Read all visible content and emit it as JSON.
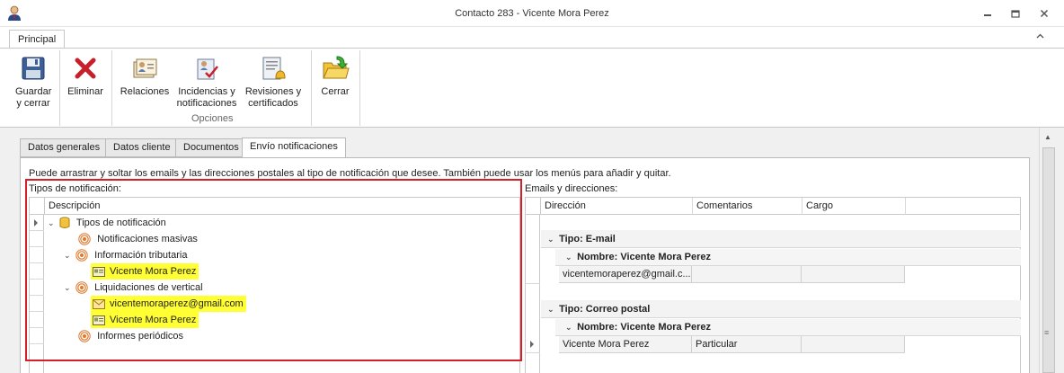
{
  "window": {
    "title": "Contacto 283 - Vicente Mora Perez",
    "minimize_icon": "minimize-icon",
    "restore_icon": "restore-icon",
    "close_icon": "close-icon"
  },
  "ribbon": {
    "tab": "Principal",
    "buttons": {
      "save": "Guardar y cerrar",
      "delete": "Eliminar",
      "relations": "Relaciones",
      "incidents": "Incidencias y notificaciones",
      "revisions": "Revisiones y certificados",
      "close": "Cerrar"
    },
    "group_label": "Opciones"
  },
  "tabs": [
    "Datos generales",
    "Datos cliente",
    "Documentos",
    "Envío notificaciones"
  ],
  "active_tab": "Envío notificaciones",
  "instructions": "Puede arrastrar y soltar los emails y las direcciones postales al tipo de notificación que desee. También puede usar los menús para añadir y quitar.",
  "left": {
    "label": "Tipos de notificación:",
    "column": "Descripción",
    "tree": {
      "root": "Tipos de notificación",
      "n1": "Notificaciones masivas",
      "n2": "Información tributaria",
      "n2_child": "Vicente Mora Perez",
      "n3": "Liquidaciones de vertical",
      "n3_email": "vicentemoraperez@gmail.com",
      "n3_child": "Vicente Mora Perez",
      "n4": "Informes periódicos"
    },
    "highlight_color": "#ffff33",
    "box_color": "#d4202a"
  },
  "right": {
    "label": "Emails y direcciones:",
    "columns": [
      "Dirección",
      "Comentarios",
      "Cargo"
    ],
    "groups": [
      {
        "type": "Tipo: E-mail",
        "name": "Nombre: Vicente Mora Perez",
        "row": [
          "vicentemoraperez@gmail.c...",
          "",
          ""
        ]
      },
      {
        "type": "Tipo: Correo postal",
        "name": "Nombre: Vicente Mora Perez",
        "row": [
          "Vicente Mora Perez",
          "Particular",
          ""
        ]
      }
    ]
  }
}
